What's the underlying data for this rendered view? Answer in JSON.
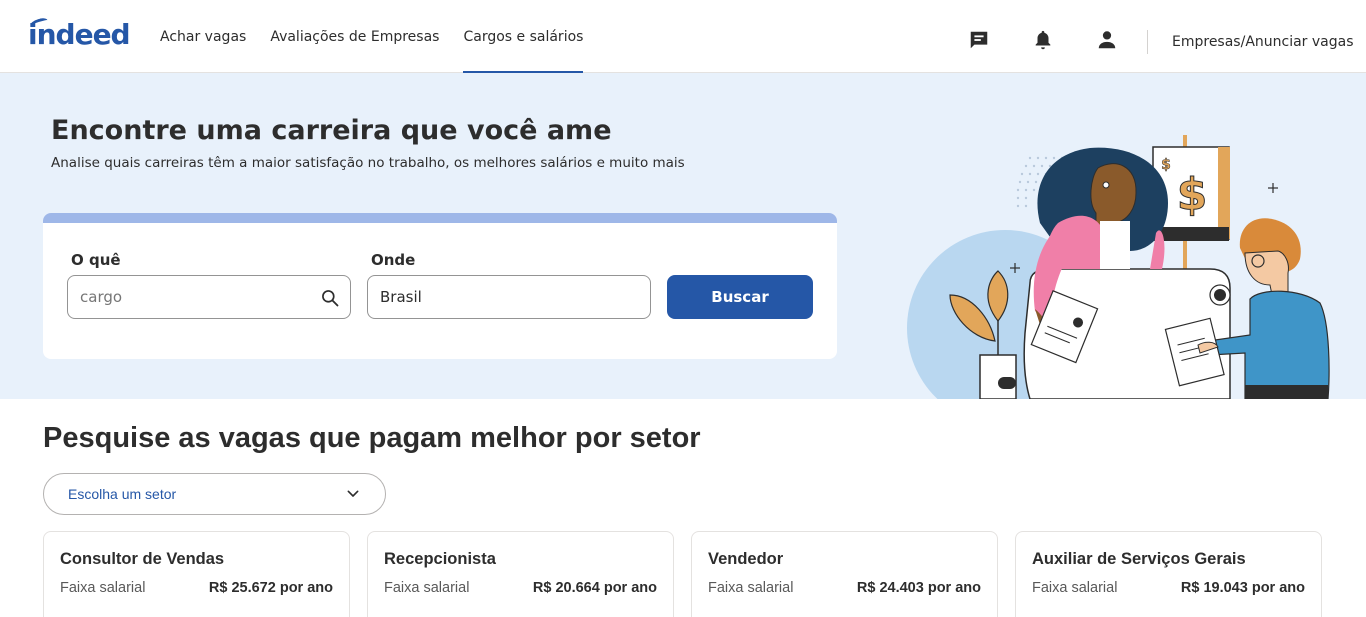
{
  "header": {
    "logo": "indeed",
    "nav": [
      {
        "label": "Achar vagas",
        "active": false
      },
      {
        "label": "Avaliações de Empresas",
        "active": false
      },
      {
        "label": "Cargos e salários",
        "active": true
      }
    ],
    "icons": [
      "messages-icon",
      "notifications-icon",
      "account-icon"
    ],
    "employers_link": "Empresas/Anunciar vagas"
  },
  "hero": {
    "title": "Encontre uma carreira que você ame",
    "subtitle": "Analise quais carreiras têm a maior satisfação no trabalho, os melhores salários e muito mais",
    "what_label": "O quê",
    "what_placeholder": "cargo",
    "where_label": "Onde",
    "where_value": "Brasil",
    "search_button": "Buscar"
  },
  "section": {
    "title": "Pesquise as vagas que pagam melhor por setor",
    "sector_select": "Escolha um setor",
    "cards": [
      {
        "title": "Consultor de Vendas",
        "range_label": "Faixa salarial",
        "salary": "R$ 25.672 por ano"
      },
      {
        "title": "Recepcionista",
        "range_label": "Faixa salarial",
        "salary": "R$ 20.664 por ano"
      },
      {
        "title": "Vendedor",
        "range_label": "Faixa salarial",
        "salary": "R$ 24.403 por ano"
      },
      {
        "title": "Auxiliar de Serviços Gerais",
        "range_label": "Faixa salarial",
        "salary": "R$ 19.043 por ano"
      }
    ]
  },
  "colors": {
    "brand": "#2557a7",
    "hero_bg": "#e8f1fb",
    "search_topbar": "#9eb7e8"
  }
}
